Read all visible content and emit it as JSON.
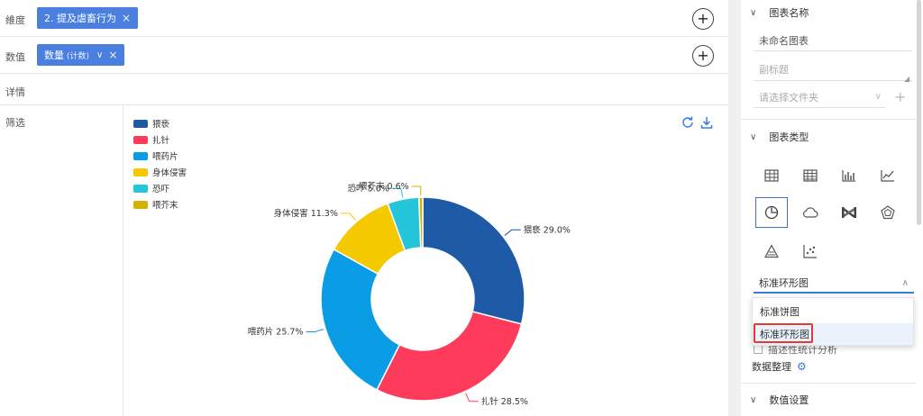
{
  "fields": {
    "dimension": {
      "label": "維度",
      "chip": "2. 提及虐畜行为"
    },
    "value": {
      "label": "数值",
      "chip": "数量",
      "chip_sub": "(计数)"
    },
    "detail": {
      "label": "详情"
    },
    "filter": {
      "label": "筛选"
    }
  },
  "chart_data": {
    "type": "pie",
    "donut": true,
    "categories": [
      "猥亵",
      "扎针",
      "喂药片",
      "身体侵害",
      "恐吓",
      "喂芥末"
    ],
    "values": [
      29.0,
      28.5,
      25.7,
      11.3,
      5.0,
      0.6
    ],
    "labels": [
      "猥亵 29.0%",
      "扎针 28.5%",
      "喂药片 25.7%",
      "身体侵害 11.3%",
      "恐吓 5.0%",
      "喂芥末 0.6%"
    ],
    "colors": [
      "#1f5aa6",
      "#ff3b5c",
      "#0a9de6",
      "#f5c900",
      "#26c6da",
      "#d4b106"
    ],
    "legend_position": "top-left"
  },
  "panel": {
    "chart_name": {
      "title": "图表名称",
      "name_value": "未命名图表",
      "subtitle_placeholder": "副标题",
      "folder_placeholder": "请选择文件夹",
      "plus": "+"
    },
    "chart_type": {
      "title": "图表类型",
      "icons": [
        "table-icon",
        "pivot-table-icon",
        "bar-chart-icon",
        "line-chart-icon",
        "pie-chart-icon",
        "cloud-chart-icon",
        "sankey-icon",
        "radar-icon",
        "funnel-icon",
        "scatter-icon"
      ],
      "selected": "标准环形图",
      "options": [
        "标准饼图",
        "标准环形图"
      ]
    },
    "checkbox_label": "描述性统计分析",
    "data_org_label": "数据整理",
    "value_settings_title": "数值设置"
  }
}
